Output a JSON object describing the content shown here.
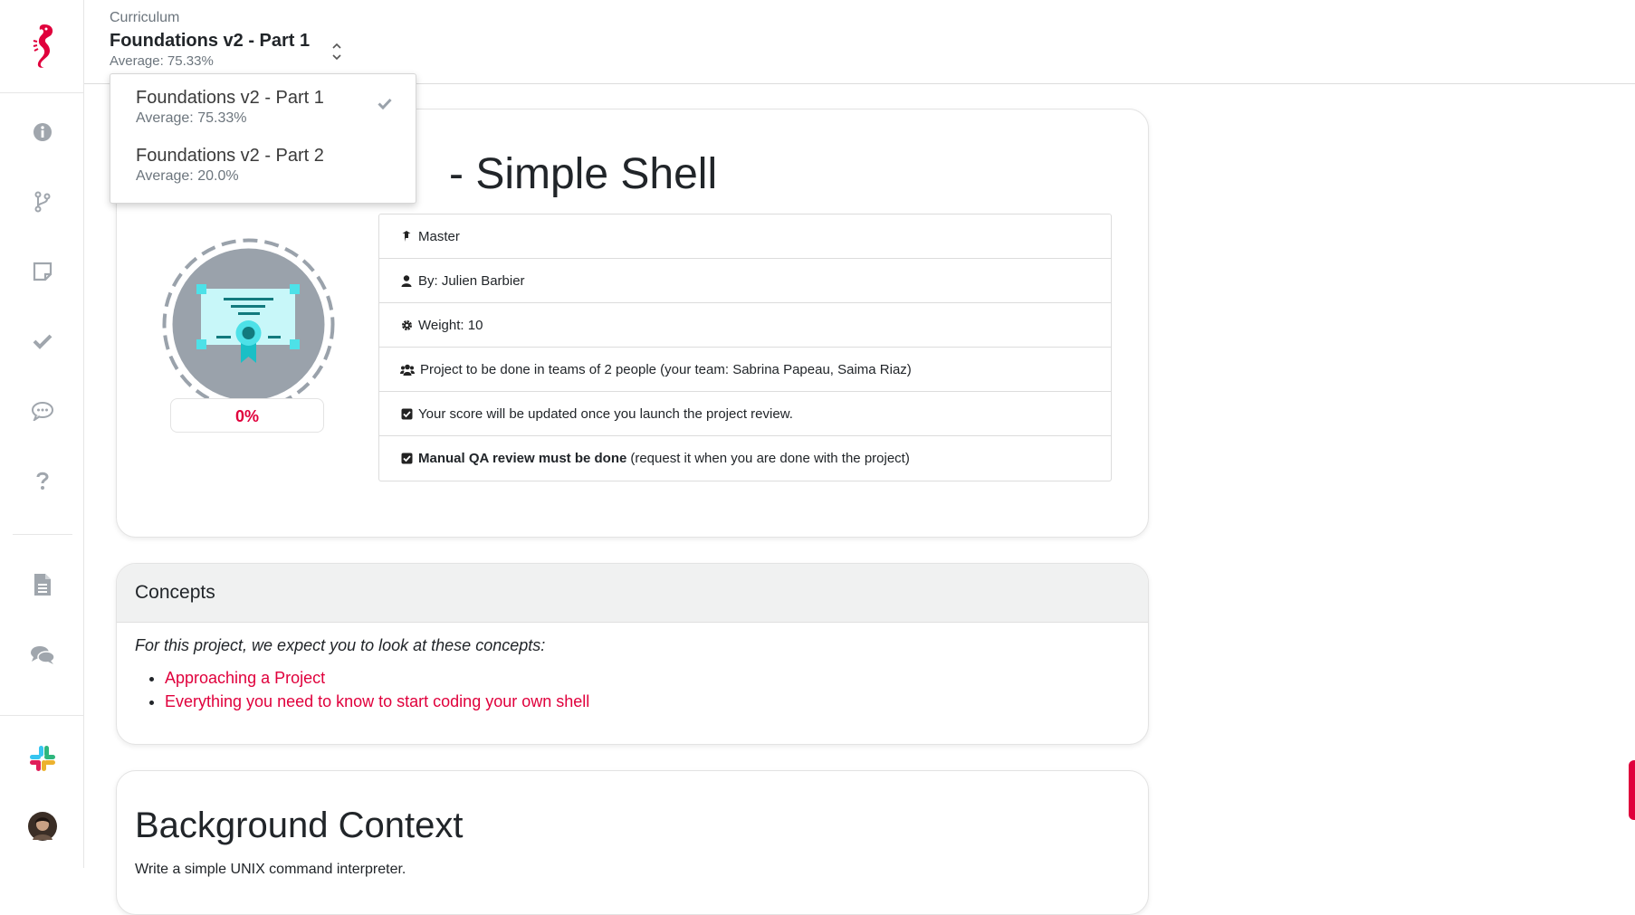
{
  "curriculum": {
    "label": "Curriculum",
    "title": "Foundations v2 - Part 1",
    "average": "Average: 75.33%"
  },
  "dropdown": {
    "items": [
      {
        "title": "Foundations v2 - Part 1",
        "average": "Average: 75.33%",
        "selected": true
      },
      {
        "title": "Foundations v2 - Part 2",
        "average": "Average: 20.0%",
        "selected": false
      }
    ]
  },
  "sidebar": {
    "logo": "seahorse-logo",
    "icons": [
      "info-icon",
      "branch-icon",
      "note-icon",
      "check-icon",
      "chat-bubble-icon",
      "question-icon",
      "document-icon",
      "comments-icon",
      "slack-icon",
      "avatar"
    ]
  },
  "project": {
    "title": "- Simple Shell",
    "score": "0%",
    "info": {
      "level": "Master",
      "author": "By: Julien Barbier",
      "weight": "Weight: 10",
      "team": "Project to be done in teams of 2 people (your team: Sabrina Papeau, Saima Riaz)",
      "score_note": "Your score will be updated once you launch the project review.",
      "qa_bold": "Manual QA review must be done",
      "qa_rest": "(request it when you are done with the project)"
    }
  },
  "concepts": {
    "title": "Concepts",
    "intro": "For this project, we expect you to look at these concepts:",
    "links": [
      "Approaching a Project",
      "Everything you need to know to start coding your own shell"
    ]
  },
  "background": {
    "title": "Background Context",
    "text": "Write a simple UNIX command interpreter."
  },
  "colors": {
    "accent": "#e0003c",
    "badge_teal": "#4de1e8",
    "badge_bg": "#9aa2ab"
  }
}
